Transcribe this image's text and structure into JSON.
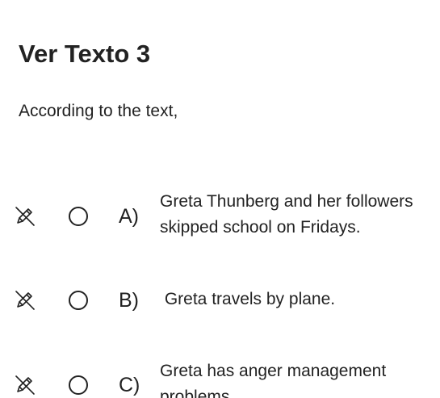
{
  "question": {
    "title": "Ver Texto 3",
    "prompt": "According to the text,"
  },
  "options": [
    {
      "letter": "A)",
      "text": "Greta Thunberg and her followers skipped school on Fridays."
    },
    {
      "letter": "B)",
      "text": " Greta travels by plane."
    },
    {
      "letter": "C)",
      "text": "Greta has anger management problems."
    }
  ],
  "icons": {
    "eliminate": "pencil-slash-icon",
    "select": "radio-circle-icon"
  },
  "colors": {
    "text": "#222222",
    "background": "#ffffff"
  }
}
